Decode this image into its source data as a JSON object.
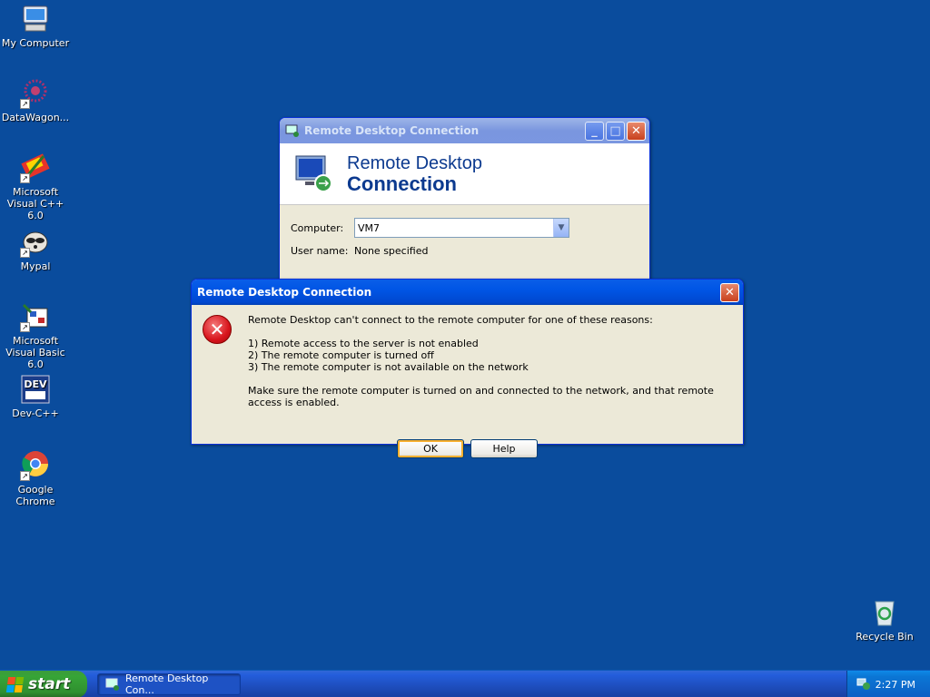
{
  "desktop": {
    "icons_left": [
      {
        "label": "My Computer",
        "icon": "my-computer-icon"
      },
      {
        "label": "DataWagon...",
        "icon": "datawagon-icon"
      },
      {
        "label": "Microsoft Visual C++ 6.0",
        "icon": "visual-cpp-icon"
      },
      {
        "label": "Mypal",
        "icon": "mypal-icon"
      },
      {
        "label": "Microsoft Visual Basic 6.0",
        "icon": "visual-basic-icon"
      },
      {
        "label": "Dev-C++",
        "icon": "dev-cpp-icon"
      },
      {
        "label": "Google Chrome",
        "icon": "chrome-icon"
      }
    ],
    "recycle_bin": {
      "label": "Recycle Bin",
      "icon": "recycle-bin-icon"
    }
  },
  "rdc_window": {
    "title": "Remote Desktop Connection",
    "banner_line1": "Remote Desktop",
    "banner_line2": "Connection",
    "computer_label": "Computer:",
    "computer_value": "VM7",
    "username_label": "User name:",
    "username_value": "None specified"
  },
  "error_dialog": {
    "title": "Remote Desktop Connection",
    "intro": "Remote Desktop can't connect to the remote computer for one of these reasons:",
    "reasons": [
      "1) Remote access to the server is not enabled",
      "2) The remote computer is turned off",
      "3) The remote computer is not available on the network"
    ],
    "advice": "Make sure the remote computer is turned on and connected to the network, and that remote access is enabled.",
    "ok_label": "OK",
    "help_label": "Help"
  },
  "taskbar": {
    "start_label": "start",
    "task_label": "Remote Desktop Con...",
    "clock": "2:27 PM"
  },
  "colors": {
    "desktop": "#0a4c9d",
    "titlebar_active": "#0055e5",
    "dialog_bg": "#ece9d8"
  }
}
